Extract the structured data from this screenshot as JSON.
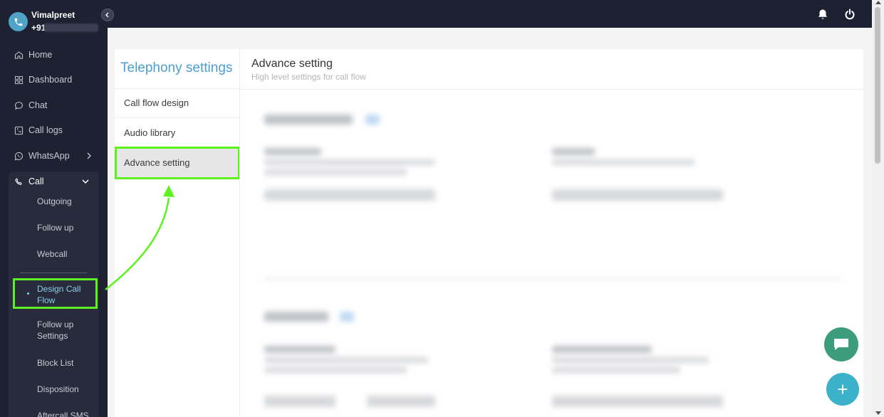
{
  "user": {
    "name": "Vimalpreet",
    "phone": "+91"
  },
  "sidebar": {
    "items": [
      {
        "label": "Home",
        "icon": "home-icon"
      },
      {
        "label": "Dashboard",
        "icon": "grid-icon"
      },
      {
        "label": "Chat",
        "icon": "chat-icon"
      },
      {
        "label": "Call logs",
        "icon": "call-log-icon"
      },
      {
        "label": "WhatsApp",
        "icon": "whatsapp-icon"
      },
      {
        "label": "Call",
        "icon": "phone-icon"
      }
    ],
    "call_subitems": [
      {
        "label": "Outgoing"
      },
      {
        "label": "Follow up"
      },
      {
        "label": "Webcall"
      },
      {
        "label": "Design Call Flow",
        "active": true
      },
      {
        "label": "Follow up Settings"
      },
      {
        "label": "Block List"
      },
      {
        "label": "Disposition"
      },
      {
        "label": "Aftercall SMS"
      }
    ]
  },
  "settings_nav": {
    "title": "Telephony settings",
    "items": [
      "Call flow design",
      "Audio library",
      "Advance setting"
    ],
    "active": "Advance setting"
  },
  "content": {
    "title": "Advance setting",
    "subtitle": "High level settings for call flow"
  },
  "colors": {
    "sidebar_bg": "#1e2131",
    "highlight": "#5cf21f",
    "accent": "#4a9fd0",
    "fab_chat": "#3c9d7c",
    "fab_add": "#3bb2c9"
  },
  "fab": {
    "add_label": "+"
  }
}
